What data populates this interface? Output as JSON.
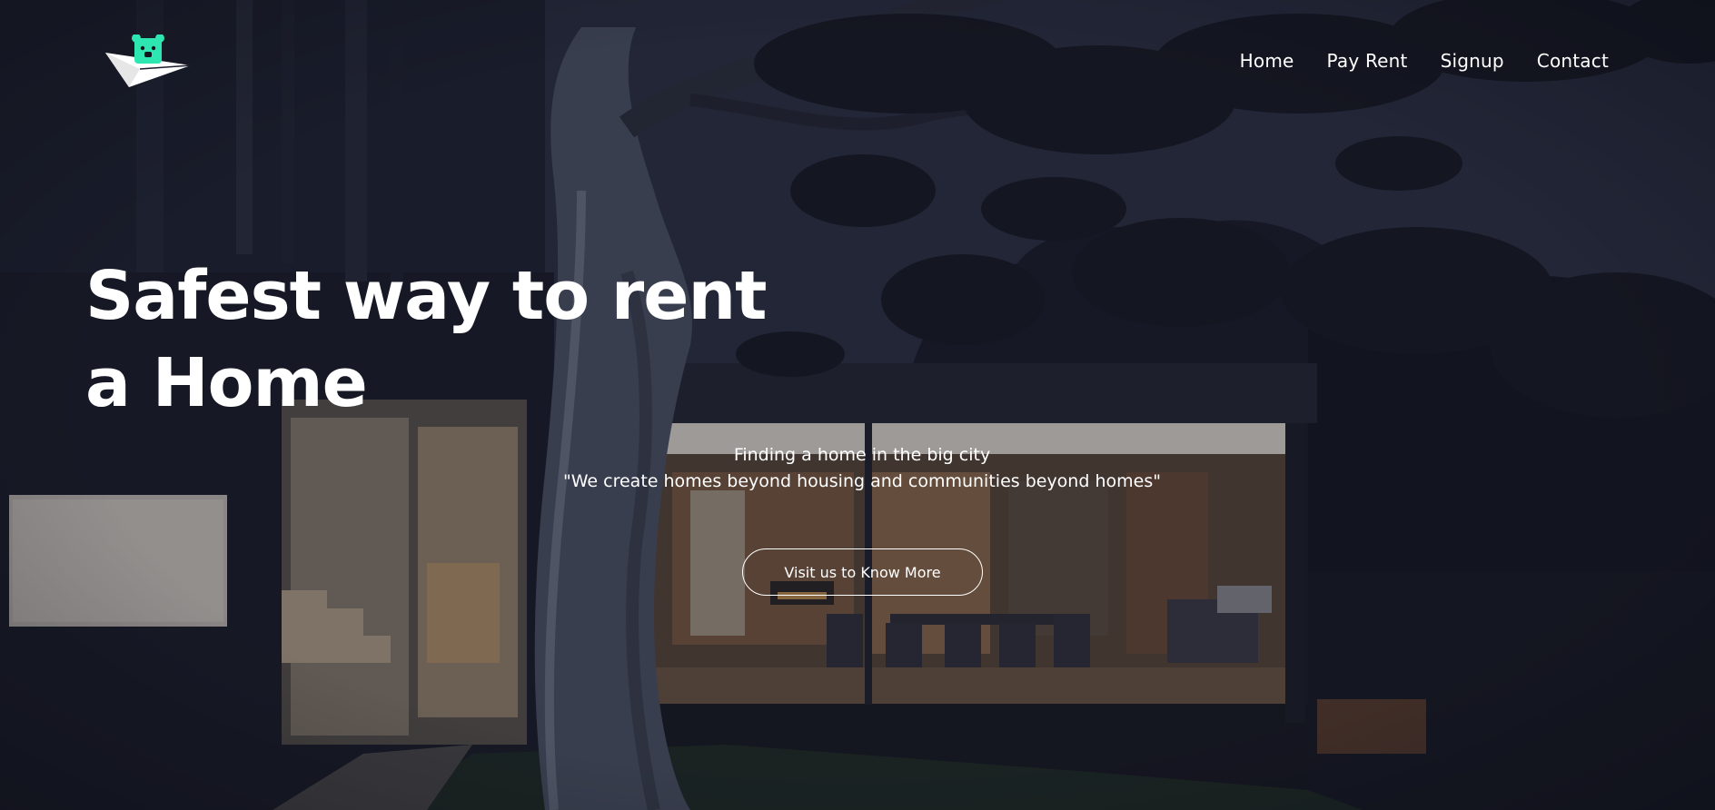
{
  "nav": {
    "items": [
      {
        "label": "Home"
      },
      {
        "label": "Pay Rent"
      },
      {
        "label": "Signup"
      },
      {
        "label": "Contact"
      }
    ]
  },
  "hero": {
    "headline": "Safest way to rent a Home",
    "tagline_line1": "Finding a home in the big city",
    "tagline_line2": "\"We create homes beyond housing and communities beyond homes\"",
    "cta_label": "Visit us to Know More"
  },
  "brand": {
    "logo_icon": "paper-plane-bear-logo",
    "accent": "#2ee6b0"
  }
}
